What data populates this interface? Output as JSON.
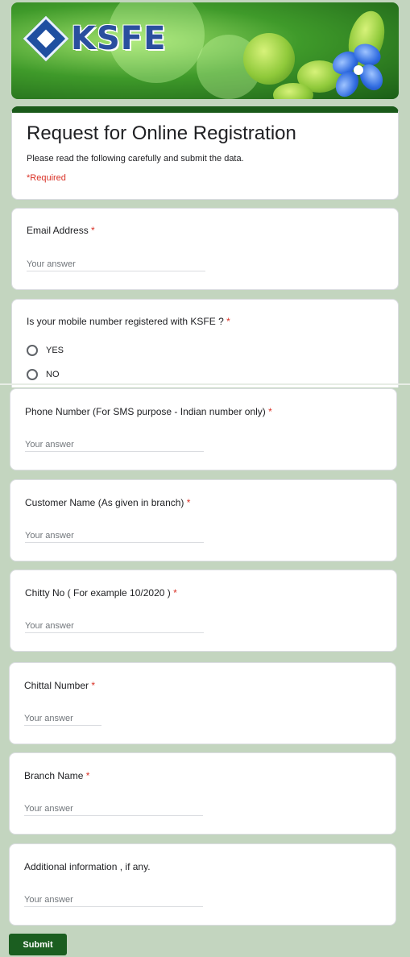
{
  "header": {
    "logo_text": "KSFE"
  },
  "form": {
    "title": "Request for Online Registration",
    "description": "Please read the following carefully and submit the data.",
    "required_note": "*Required",
    "answer_placeholder": "Your answer",
    "questions": [
      {
        "label": "Email Address",
        "required_mark": "*"
      },
      {
        "label": "Is your mobile number registered with KSFE ?",
        "required_mark": "*",
        "options": [
          "YES",
          "NO"
        ]
      },
      {
        "label": "Phone Number (For SMS purpose - Indian number only)",
        "required_mark": "*"
      },
      {
        "label": "Customer Name (As given in branch)",
        "required_mark": "*"
      },
      {
        "label": "Chitty No ( For example 10/2020 )",
        "required_mark": "*"
      },
      {
        "label": "Chittal Number",
        "required_mark": "*"
      },
      {
        "label": "Branch Name",
        "required_mark": "*"
      },
      {
        "label": "Additional information , if any.",
        "required_mark": ""
      }
    ],
    "submit_label": "Submit"
  },
  "colors": {
    "page_background": "#c3d5bf",
    "header_accent": "#1a5a1a",
    "required_red": "#d93025",
    "submit_green": "#1b5e20"
  },
  "icons": {
    "logo": "ksfe-diamond-logo-icon",
    "radio": "radio-unchecked-icon"
  }
}
